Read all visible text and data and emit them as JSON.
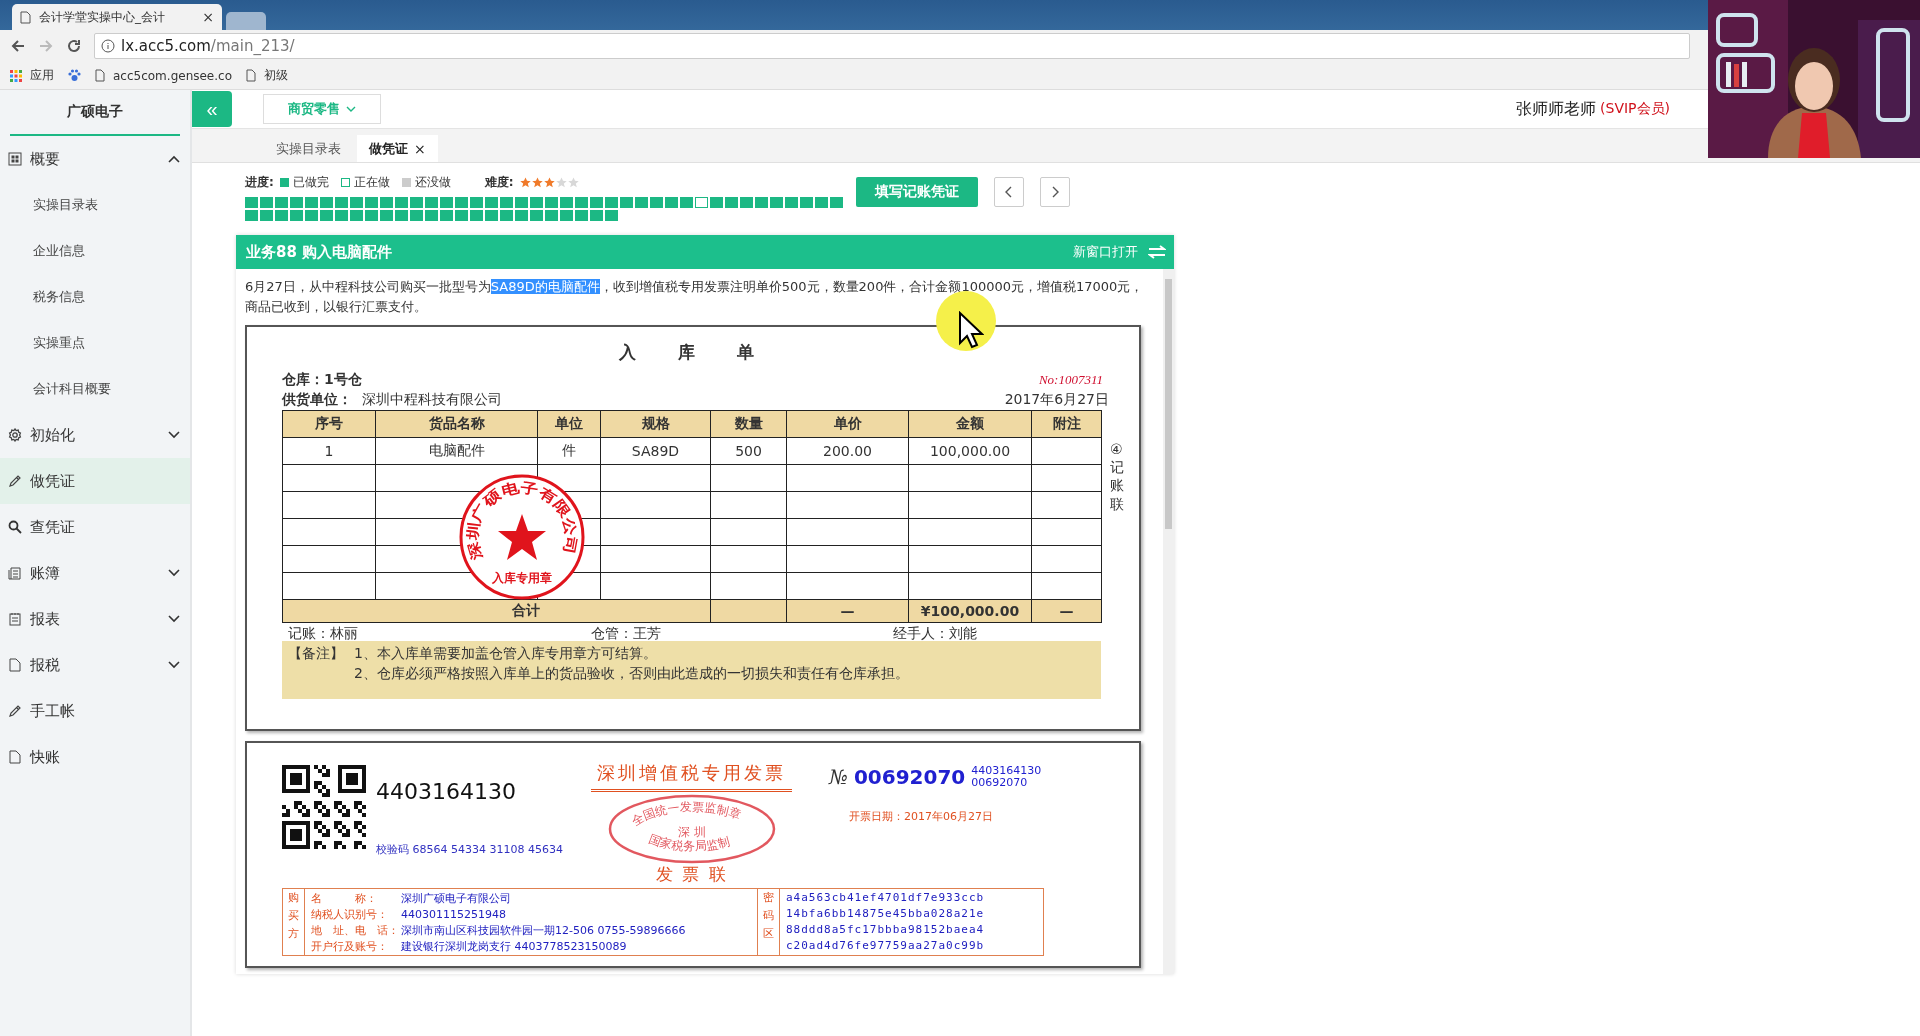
{
  "browser": {
    "tabs": [
      {
        "title": "会计学堂实操中心_会计",
        "selected": true,
        "close": "×"
      },
      {
        "selected": false
      }
    ],
    "url_host": "lx.acc5.com",
    "url_path": "/main_213/",
    "bookmarks": [
      {
        "label": "应用",
        "kind": "apps"
      },
      {
        "kind": "paw"
      },
      {
        "label": "acc5com.gensee.co",
        "kind": "page"
      },
      {
        "label": "初级",
        "kind": "page"
      }
    ]
  },
  "header": {
    "collapse": "«",
    "industry": "商贸零售",
    "user": "张师师老师",
    "badge": "(SVIP会员)"
  },
  "sidebar": {
    "company": "广硕电子",
    "items": [
      {
        "label": "概要",
        "expanded": true,
        "selected": false,
        "children": [
          {
            "label": "实操目录表"
          },
          {
            "label": "企业信息"
          },
          {
            "label": "税务信息"
          },
          {
            "label": "实操重点"
          },
          {
            "label": "会计科目概要"
          }
        ]
      },
      {
        "label": "初始化",
        "expanded": false,
        "selected": false
      },
      {
        "label": "做凭证",
        "selected": true
      },
      {
        "label": "查凭证",
        "selected": false
      },
      {
        "label": "账簿",
        "expanded": false,
        "selected": false
      },
      {
        "label": "报表",
        "expanded": false,
        "selected": false
      },
      {
        "label": "报税",
        "expanded": false,
        "selected": false
      },
      {
        "label": "手工帐",
        "selected": false
      },
      {
        "label": "快账",
        "selected": false
      }
    ]
  },
  "page_tabs": [
    {
      "label": "实操目录表",
      "selected": false
    },
    {
      "label": "做凭证",
      "selected": true,
      "close": "×"
    }
  ],
  "progress": {
    "label": "进度:",
    "legend": [
      {
        "label": "已做完",
        "kind": "done"
      },
      {
        "label": "正在做",
        "kind": "doing"
      },
      {
        "label": "还没做",
        "kind": "todo"
      }
    ],
    "difficulty_label": "难度:",
    "stars": 3,
    "cells": [
      {
        "kind": "done"
      },
      {
        "kind": "done"
      },
      {
        "kind": "done"
      },
      {
        "kind": "done"
      },
      {
        "kind": "done"
      },
      {
        "kind": "done"
      },
      {
        "kind": "done"
      },
      {
        "kind": "done"
      },
      {
        "kind": "done"
      },
      {
        "kind": "done"
      },
      {
        "kind": "done"
      },
      {
        "kind": "done"
      },
      {
        "kind": "done"
      },
      {
        "kind": "done"
      },
      {
        "kind": "done"
      },
      {
        "kind": "done"
      },
      {
        "kind": "done"
      },
      {
        "kind": "done"
      },
      {
        "kind": "done"
      },
      {
        "kind": "done"
      },
      {
        "kind": "done"
      },
      {
        "kind": "done"
      },
      {
        "kind": "done"
      },
      {
        "kind": "done"
      },
      {
        "kind": "done"
      },
      {
        "kind": "done"
      },
      {
        "kind": "done"
      },
      {
        "kind": "done"
      },
      {
        "kind": "done"
      },
      {
        "kind": "done"
      },
      {
        "kind": "doing"
      },
      {
        "kind": "done"
      },
      {
        "kind": "done"
      },
      {
        "kind": "done"
      },
      {
        "kind": "done"
      },
      {
        "kind": "done"
      },
      {
        "kind": "done"
      },
      {
        "kind": "done"
      },
      {
        "kind": "done"
      },
      {
        "kind": "done"
      },
      {
        "kind": "done"
      },
      {
        "kind": "done"
      },
      {
        "kind": "done"
      },
      {
        "kind": "done"
      },
      {
        "kind": "done"
      },
      {
        "kind": "done"
      },
      {
        "kind": "done"
      },
      {
        "kind": "done"
      },
      {
        "kind": "done"
      },
      {
        "kind": "done"
      },
      {
        "kind": "done"
      },
      {
        "kind": "done"
      },
      {
        "kind": "done"
      },
      {
        "kind": "done"
      },
      {
        "kind": "done"
      },
      {
        "kind": "done"
      },
      {
        "kind": "done"
      },
      {
        "kind": "done"
      },
      {
        "kind": "done"
      },
      {
        "kind": "done"
      },
      {
        "kind": "done"
      },
      {
        "kind": "done"
      },
      {
        "kind": "done"
      },
      {
        "kind": "done"
      },
      {
        "kind": "done"
      }
    ]
  },
  "action_button": "填写记账凭证",
  "task": {
    "title": "业务88 购入电脑配件",
    "open_new": "新窗口打开",
    "description": [
      {
        "text": "6月27日，从中程科技公司购买一批型号为",
        "selected": false
      },
      {
        "text": "SA89D的电脑配件",
        "selected": true
      },
      {
        "text": "，收到增值税专用发票注明单价500元，数量200件，合计金额100000元，增值税17000元，商品已收到，以银行汇票支付。",
        "selected": false
      }
    ]
  },
  "receipt": {
    "title": "入 库 单",
    "warehouse": "仓库：1号仓",
    "number": "No:1007311",
    "supplier_label": "供货单位：",
    "supplier": "深圳中程科技有限公司",
    "date": "2017年6月27日",
    "columns": [
      "序号",
      "货品名称",
      "单位",
      "规格",
      "数量",
      "单价",
      "金额",
      "附注"
    ],
    "rows": [
      [
        "1",
        "电脑配件",
        "件",
        "SA89D",
        "500",
        "200.00",
        "100,000.00",
        ""
      ]
    ],
    "total": {
      "label": "合计",
      "price": "—",
      "amount": "¥100,000.00",
      "note": "—"
    },
    "side_label": "④记账联",
    "signatures": [
      "记账：林丽",
      "仓管：王芳",
      "经手人：刘能"
    ],
    "notes_label": "【备注】",
    "notes": [
      "1、本入库单需要加盖仓管入库专用章方可结算。",
      "2、仓库必须严格按照入库单上的货品验收，否则由此造成的一切损失和责任有仓库承担。"
    ],
    "seal": {
      "ring": "深圳广硕电子有限公司",
      "bottom": "入库专用章"
    }
  },
  "invoice": {
    "code": "4403164130",
    "title": "深圳增值税专用发票",
    "subtitle": "发 票 联",
    "no_label": "№",
    "number": "00692070",
    "code_small": "4403164130",
    "number_small": "00692070",
    "check_code": "校验码 68564 54334 31108 45634",
    "date": "开票日期：2017年06月27日",
    "seal": {
      "top": "全国统一发票监制章",
      "center": "深 圳",
      "bottom": "国家税务局监制"
    },
    "buyer_label": "购买方",
    "buyer_rows": [
      {
        "label": "名　　　称：",
        "value": "深圳广硕电子有限公司"
      },
      {
        "label": "纳税人识别号：",
        "value": "440301115251948"
      },
      {
        "label": "地　址、电　话：",
        "value": "深圳市南山区科技园软件园一期12-506 0755-59896666"
      },
      {
        "label": "开户行及账号：",
        "value": "建设银行深圳龙岗支行 4403778523150089"
      }
    ],
    "cipher_label": "密码区",
    "cipher_lines": [
      "a4a563cb41ef4701df7e933ccb",
      "14bfa6bb14875e45bba028a21e",
      "88ddd8a5fc17bbba98152baea4",
      "c20ad4d76fe97759aa27a0c99b"
    ]
  }
}
